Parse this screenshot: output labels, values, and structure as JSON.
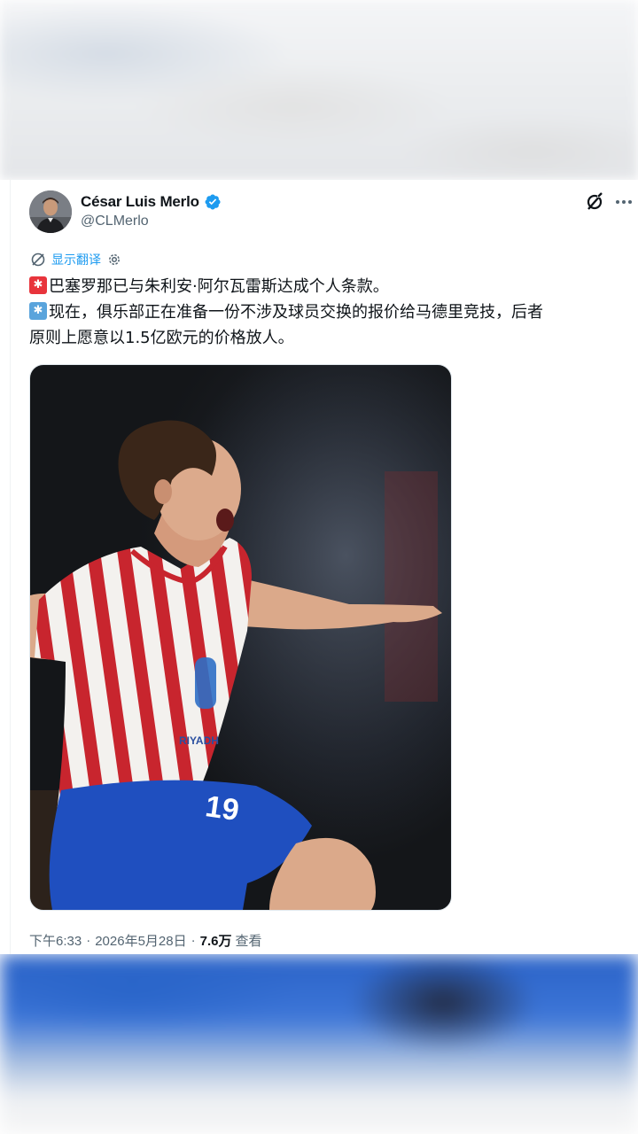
{
  "author": {
    "display_name": "César Luis Merlo",
    "handle": "@CLMerlo",
    "verified": true,
    "avatar": "avatar-photo"
  },
  "header_actions": {
    "grok_icon": "grok-icon",
    "more_icon": "more-icon"
  },
  "translate": {
    "label": "显示翻译",
    "icon": "globe-icon",
    "settings_icon": "gear-icon"
  },
  "tweet": {
    "line1_emoji": "siren-emoji",
    "line1": "巴塞罗那已与朱利安·阿尔瓦雷斯达成个人条款。",
    "line2_emoji": "snowflake-emoji",
    "line2": "现在，俱乐部正在准备一份不涉及球员交换的报价给马德里竞技，后者",
    "line3": "原则上愿意以1.5亿欧元的价格放人。"
  },
  "media": {
    "kind": "photo",
    "jersey_number": "19",
    "sponsor": "RIYADH"
  },
  "meta": {
    "time": "下午6:33",
    "separator": "·",
    "date": "2026年5月28日",
    "views": "7.6万",
    "views_label": "查看"
  },
  "colors": {
    "link": "#1d9bf0",
    "verified": "#1d9bf0",
    "text": "#0f1419",
    "secondary": "#536471"
  }
}
